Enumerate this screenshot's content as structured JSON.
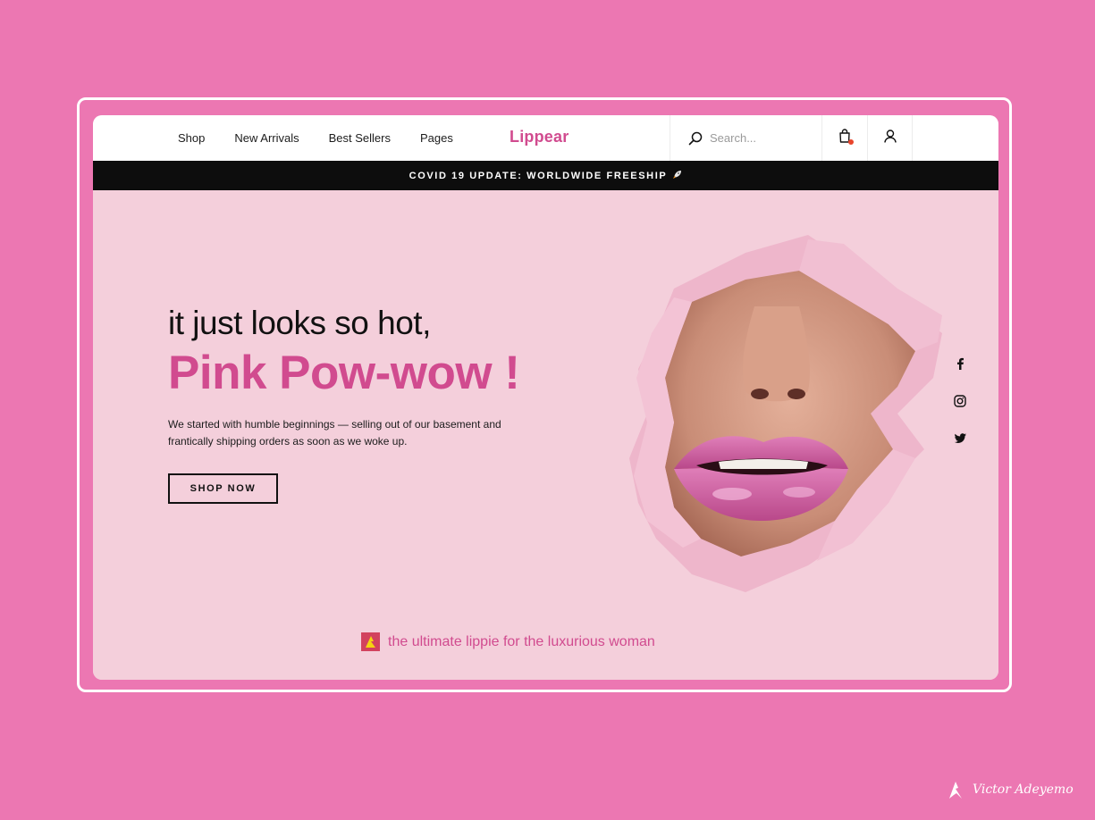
{
  "nav": {
    "items": [
      "Shop",
      "New Arrivals",
      "Best Sellers",
      "Pages"
    ]
  },
  "brand": {
    "name": "Lippear"
  },
  "search": {
    "placeholder": "Search..."
  },
  "announcement": {
    "text": "COVID 19 UPDATE: WORLDWIDE FREESHIP",
    "icon": "rocket-icon"
  },
  "hero": {
    "heading_line1": "it just looks so hot,",
    "heading_line2": "Pink Pow-wow !",
    "description": "We started with humble beginnings — selling out of our basement and frantically shipping orders as soon as we woke up.",
    "cta_label": "SHOP NOW",
    "tagline": "the ultimate lippie for the luxurious woman"
  },
  "social": [
    "facebook-icon",
    "instagram-icon",
    "twitter-icon"
  ],
  "credit": {
    "author": "Victor Adeyemo"
  },
  "colors": {
    "background": "#ec77b2",
    "brand": "#d14b8f",
    "hero": "#f4cfdb",
    "announcement_bar": "#0d0d0d",
    "cart_badge": "#e8452c"
  }
}
